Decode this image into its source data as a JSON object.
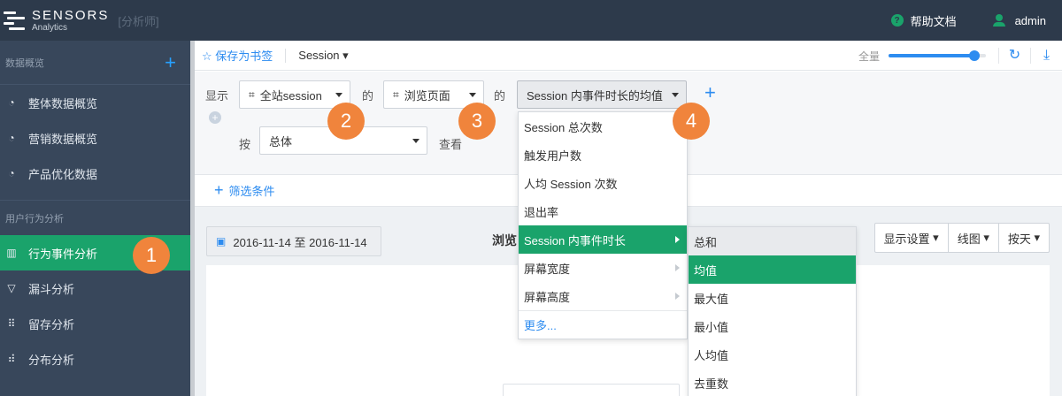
{
  "brand": {
    "name": "SENSORS",
    "sub": "Analytics",
    "role": "[分析师]"
  },
  "header": {
    "help": "帮助文档",
    "user": "admin"
  },
  "sidebar": {
    "section1": "数据概览",
    "section1_items": [
      {
        "label": "整体数据概览"
      },
      {
        "label": "营销数据概览"
      },
      {
        "label": "产品优化数据"
      }
    ],
    "section2": "用户行为分析",
    "section2_items": [
      {
        "label": "行为事件分析"
      },
      {
        "label": "漏斗分析"
      },
      {
        "label": "留存分析"
      },
      {
        "label": "分布分析"
      }
    ]
  },
  "toolbar": {
    "bookmark": "☆ 保存为书签",
    "session": "Session",
    "fullscreen": "全量",
    "zoom_fraction": 0.88
  },
  "query": {
    "show_label": "显示",
    "subject": "全站session",
    "of1": "的",
    "event": "浏览页面",
    "of2": "的",
    "metric": "Session 内事件时长的均值",
    "by_label": "按",
    "group": "总体",
    "view_label": "查看",
    "filter": "筛选条件"
  },
  "content": {
    "date_range": "2016-11-14 至 2016-11-14",
    "title": "浏览",
    "btn_display": "显示设置",
    "btn_chart": "线图",
    "btn_day": "按天"
  },
  "metric_menu": {
    "items": [
      "Session 总次数",
      "触发用户数",
      "人均 Session 次数",
      "退出率",
      "Session 内事件时长",
      "屏幕宽度",
      "屏幕高度"
    ],
    "more": "更多..."
  },
  "agg_menu": {
    "items": [
      "总和",
      "均值",
      "最大值",
      "最小值",
      "人均值",
      "去重数"
    ]
  },
  "callouts": [
    "1",
    "2",
    "3",
    "4"
  ],
  "colors": {
    "green": "#1aa36b",
    "blue": "#2d8cf0",
    "orange": "#f0843c",
    "nav": "#2d3a4b",
    "sidebar": "#38475b"
  }
}
